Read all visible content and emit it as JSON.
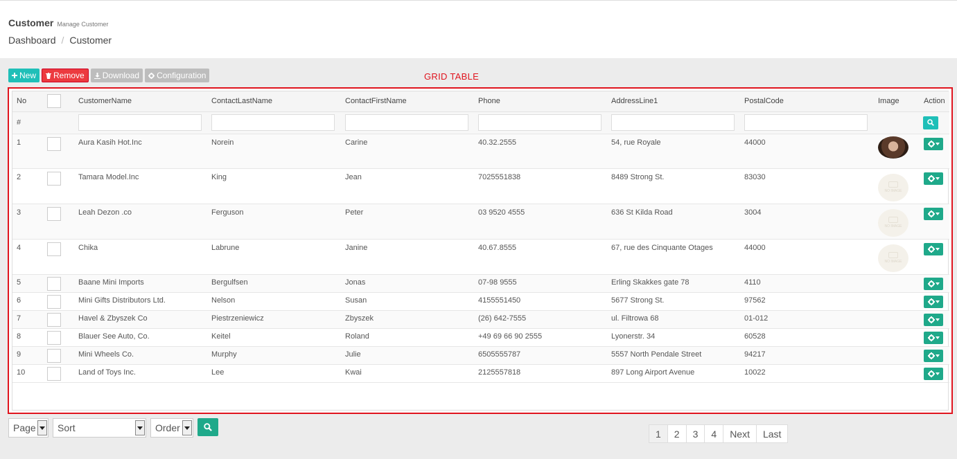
{
  "header": {
    "title": "Customer",
    "subtitle": "Manage Customer",
    "breadcrumb": [
      "Dashboard",
      "Customer"
    ]
  },
  "toolbar": {
    "new": "New",
    "remove": "Remove",
    "download": "Download",
    "configuration": "Configuration"
  },
  "grid_label": "GRID TABLE",
  "table": {
    "columns": [
      "No",
      "CustomerName",
      "ContactLastName",
      "ContactFirstName",
      "Phone",
      "AddressLine1",
      "PostalCode",
      "Image",
      "Action"
    ],
    "filter_no": "#",
    "rows": [
      {
        "no": "1",
        "name": "Aura Kasih Hot.Inc",
        "last": "Norein",
        "first": "Carine",
        "phone": "40.32.2555",
        "address": "54, rue Royale",
        "postal": "44000"
      },
      {
        "no": "2",
        "name": "Tamara Model.Inc",
        "last": "King",
        "first": "Jean",
        "phone": "7025551838",
        "address": "8489 Strong St.",
        "postal": "83030"
      },
      {
        "no": "3",
        "name": "Leah Dezon .co",
        "last": "Ferguson",
        "first": "Peter",
        "phone": "03 9520 4555",
        "address": "636 St Kilda Road",
        "postal": "3004"
      },
      {
        "no": "4",
        "name": "Chika",
        "last": "Labrune",
        "first": "Janine",
        "phone": "40.67.8555",
        "address": "67, rue des Cinquante Otages",
        "postal": "44000"
      },
      {
        "no": "5",
        "name": "Baane Mini Imports",
        "last": "Bergulfsen",
        "first": "Jonas",
        "phone": "07-98 9555",
        "address": "Erling Skakkes gate 78",
        "postal": "4110"
      },
      {
        "no": "6",
        "name": "Mini Gifts Distributors Ltd.",
        "last": "Nelson",
        "first": "Susan",
        "phone": "4155551450",
        "address": "5677 Strong St.",
        "postal": "97562"
      },
      {
        "no": "7",
        "name": "Havel & Zbyszek Co",
        "last": "Piestrzeniewicz",
        "first": "Zbyszek",
        "phone": "(26) 642-7555",
        "address": "ul. Filtrowa 68",
        "postal": "01-012"
      },
      {
        "no": "8",
        "name": "Blauer See Auto, Co.",
        "last": "Keitel",
        "first": "Roland",
        "phone": "+49 69 66 90 2555",
        "address": "Lyonerstr. 34",
        "postal": "60528"
      },
      {
        "no": "9",
        "name": "Mini Wheels Co.",
        "last": "Murphy",
        "first": "Julie",
        "phone": "6505555787",
        "address": "5557 North Pendale Street",
        "postal": "94217"
      },
      {
        "no": "10",
        "name": "Land of Toys Inc.",
        "last": "Lee",
        "first": "Kwai",
        "phone": "2125557818",
        "address": "897 Long Airport Avenue",
        "postal": "10022"
      }
    ]
  },
  "no_image_text": "NO IMAGE",
  "footer": {
    "page_select": "Page",
    "sort_select": "Sort",
    "order_select": "Order",
    "pagination": [
      "1",
      "2",
      "3",
      "4",
      "Next",
      "Last"
    ]
  },
  "colors": {
    "accent": "#1fbfb8",
    "action": "#1fa98a",
    "danger": "#ec3a3f",
    "highlight": "#e0141e"
  }
}
